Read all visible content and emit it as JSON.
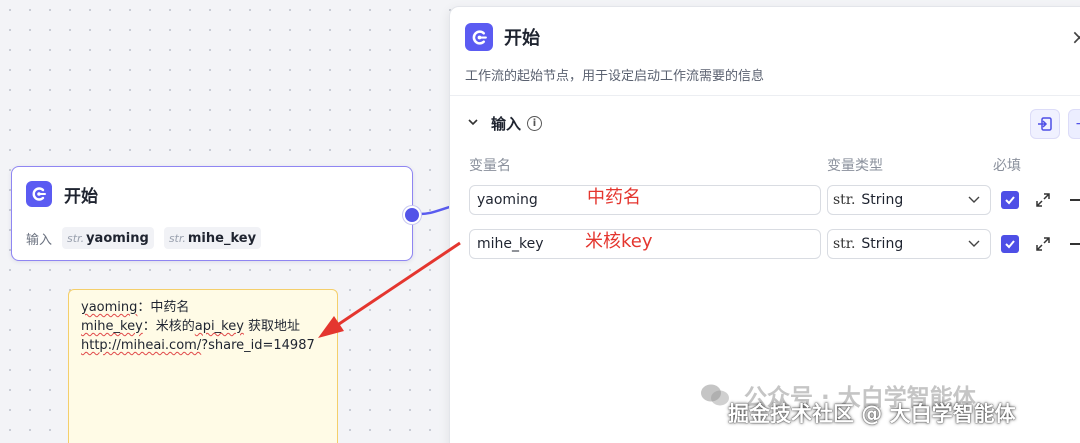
{
  "node": {
    "title": "开始",
    "inputs_label": "输入",
    "inputs": [
      {
        "type": "str.",
        "name": "yaoming"
      },
      {
        "type": "str.",
        "name": "mihe_key"
      }
    ]
  },
  "note": {
    "line1_key": "yaoming",
    "line1_rest": "：中药名",
    "line2_key": "mihe_key",
    "line2_mid": "：米核的",
    "line2_api": "api_key",
    "line2_rest": " 获取地址",
    "line3_url": "http://miheai.com/",
    "line3_rest": "?share_id=14987"
  },
  "panel": {
    "title": "开始",
    "close": "×",
    "description": "工作流的起始节点，用于设定启动工作流需要的信息",
    "section_title": "输入",
    "columns": {
      "name": "变量名",
      "type": "变量类型",
      "required": "必填"
    },
    "rows": [
      {
        "name": "yaoming",
        "annotation": "中药名",
        "type_prefix": "str.",
        "type": "String",
        "required": true
      },
      {
        "name": "mihe_key",
        "annotation": "米核key",
        "type_prefix": "str.",
        "type": "String",
        "required": true
      }
    ]
  },
  "watermark": {
    "line1": "公众号 · 大白学智能体",
    "line2": "掘金技术社区 @ 大白学智能体"
  },
  "colors": {
    "accent": "#5354e8",
    "annotation": "#e4362f",
    "note_bg": "#fffbe6"
  }
}
